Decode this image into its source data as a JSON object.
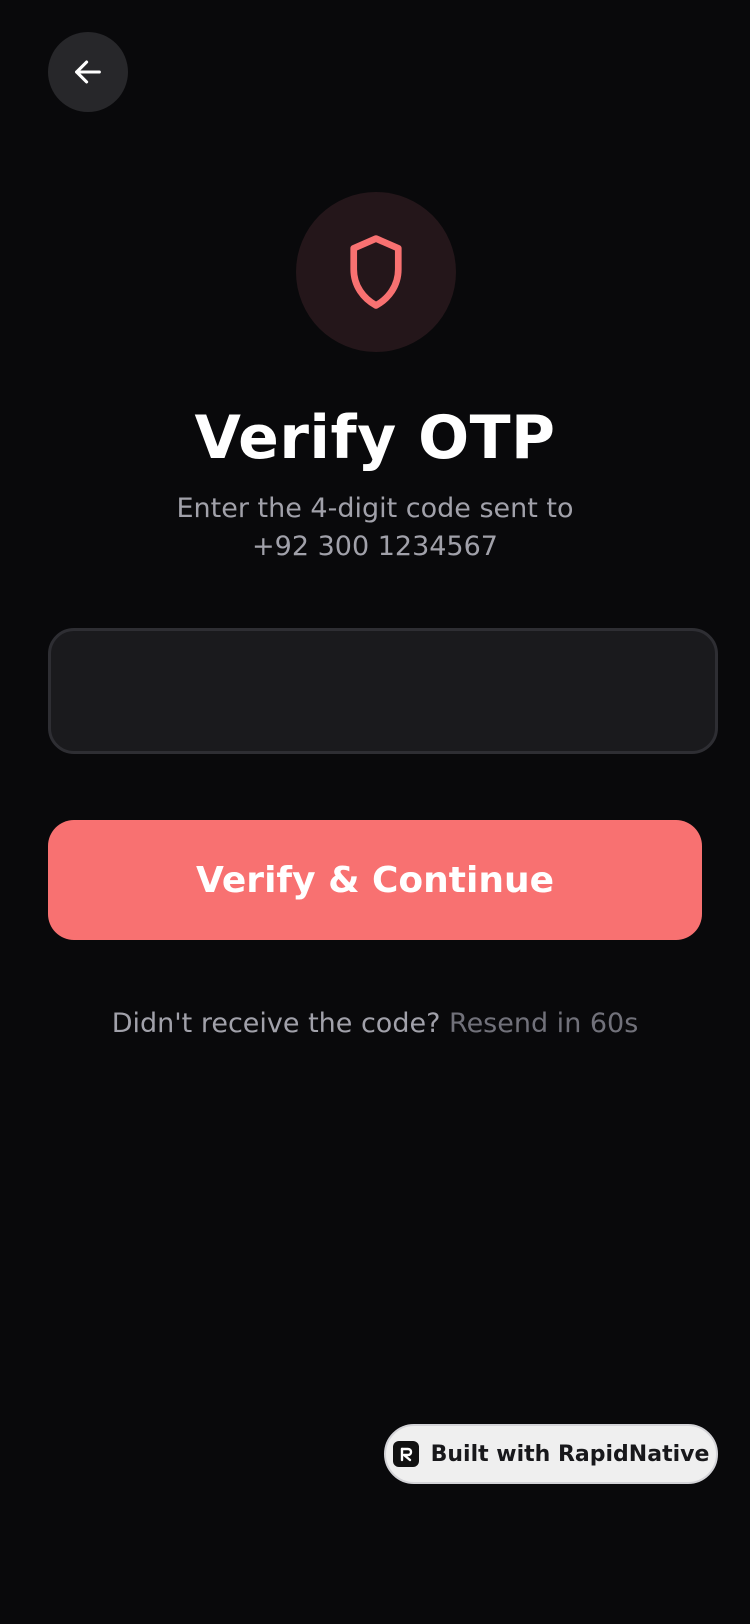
{
  "header": {
    "back_icon": "arrow-left-icon"
  },
  "hero": {
    "icon": "shield-icon",
    "title": "Verify OTP",
    "subtitle_line1": "Enter the 4-digit code sent to",
    "phone": "+92 300 1234567"
  },
  "form": {
    "otp_value": "",
    "otp_placeholder": "",
    "submit_label": "Verify & Continue"
  },
  "resend": {
    "prompt": "Didn't receive the code?",
    "timer_label": "Resend in 60s"
  },
  "badge": {
    "logo_icon": "rapidnative-logo-icon",
    "label": "Built with RapidNative"
  },
  "colors": {
    "background": "#09090b",
    "accent": "#f87171",
    "input_bg": "#1a1a1d",
    "muted_text": "#a1a1aa"
  }
}
